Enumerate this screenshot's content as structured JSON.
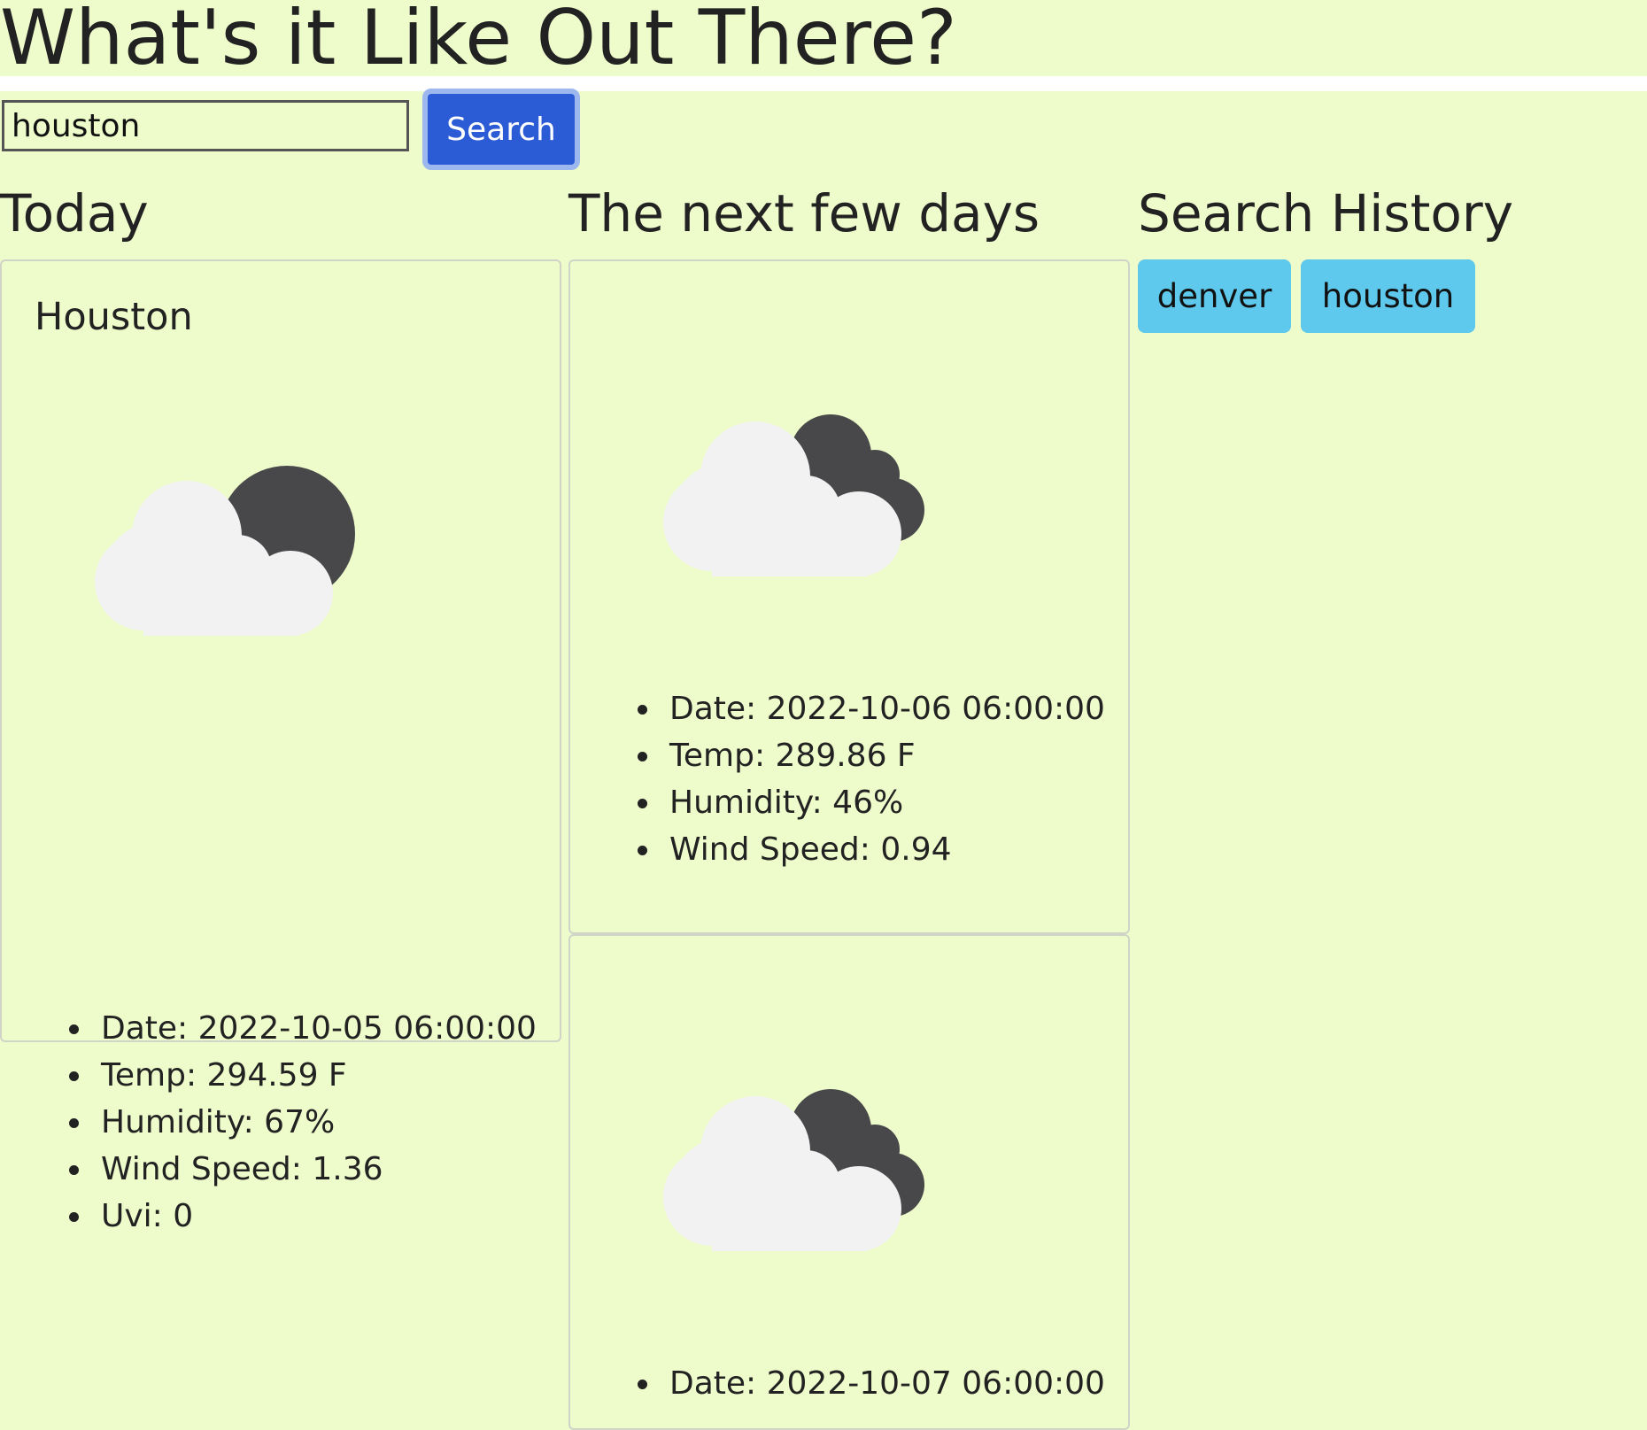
{
  "header": {
    "title": "What's it Like Out There?"
  },
  "search": {
    "value": "houston",
    "button_label": "Search"
  },
  "sections": {
    "today": "Today",
    "forecast": "The next few days",
    "history": "Search History"
  },
  "today": {
    "city": "Houston",
    "icon": "partly-cloudy-night-icon",
    "details": [
      "Date: 2022-10-05 06:00:00",
      "Temp: 294.59 F",
      "Humidity: 67%",
      "Wind Speed: 1.36",
      "Uvi: 0"
    ]
  },
  "forecast": [
    {
      "icon": "cloudy-night-icon",
      "details": [
        "Date: 2022-10-06 06:00:00",
        "Temp: 289.86 F",
        "Humidity: 46%",
        "Wind Speed: 0.94"
      ]
    },
    {
      "icon": "cloudy-night-icon",
      "details": [
        "Date: 2022-10-07 06:00:00"
      ]
    }
  ],
  "history": [
    "denver",
    "houston"
  ],
  "colors": {
    "background": "#eefccb",
    "search_button": "#2b5bd5",
    "history_button": "#5ec8ed",
    "cloud": "#f2f2f2",
    "moon": "#48484a"
  }
}
